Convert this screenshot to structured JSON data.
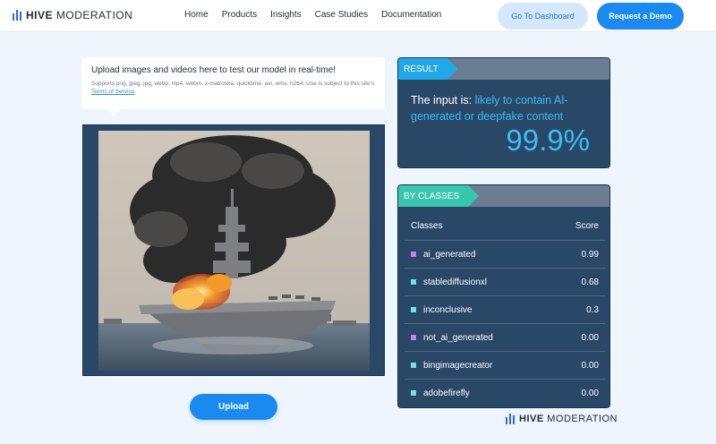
{
  "nav": {
    "logo_bold": "HIVE",
    "logo_light": "MODERATION",
    "links": [
      "Home",
      "Products",
      "Insights",
      "Case Studies",
      "Documentation"
    ],
    "dashboard_label": "Go To Dashboard",
    "demo_label": "Request a Demo"
  },
  "upload": {
    "title": "Upload images and videos here to test our model in real-time!",
    "formats_text": "Supports png, jpeg, jpg, webp, mp4, webm, x-matroska, quicktime, avi, wmv, h264. Use is subject to this site's",
    "tos_link": "Terms of Service",
    "tos_suffix": ".",
    "button_label": "Upload"
  },
  "result": {
    "tag": "RESULT",
    "prefix": "The input is:",
    "verdict": "likely to contain AI-generated or deepfake content",
    "score": "99.9%"
  },
  "classes": {
    "tag": "BY CLASSES",
    "col_class": "Classes",
    "col_score": "Score",
    "rows": [
      {
        "name": "ai_generated",
        "score": "0.99",
        "color": "#c77dea"
      },
      {
        "name": "stablediffusionxl",
        "score": "0.68",
        "color": "#6fe3e8"
      },
      {
        "name": "inconclusive",
        "score": "0.3",
        "color": "#6fe3e8"
      },
      {
        "name": "not_ai_generated",
        "score": "0.00",
        "color": "#c77dea"
      },
      {
        "name": "bingimagecreator",
        "score": "0.00",
        "color": "#6fe3e8"
      },
      {
        "name": "adobefirefly",
        "score": "0.00",
        "color": "#6fe3e8"
      }
    ]
  },
  "footer": {
    "logo_bold": "HIVE",
    "logo_light": "MODERATION"
  }
}
